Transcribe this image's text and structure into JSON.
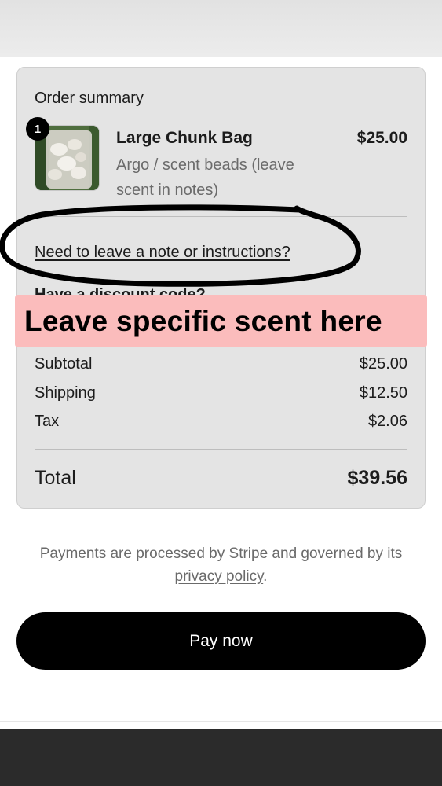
{
  "order_summary": {
    "title": "Order summary",
    "item": {
      "quantity": "1",
      "name": "Large Chunk Bag",
      "variant": "Argo / scent beads (leave scent in notes)",
      "price": "$25.00",
      "image_icon": "product-thumbnail"
    },
    "note_link": "Need to leave a note or instructions?",
    "hidden_text": "Have a discount code?",
    "subtotal_label": "Subtotal",
    "subtotal_value": "$25.00",
    "shipping_label": "Shipping",
    "shipping_value": "$12.50",
    "tax_label": "Tax",
    "tax_value": "$2.06",
    "total_label": "Total",
    "total_value": "$39.56"
  },
  "annotation": {
    "banner_text": "Leave specific scent here",
    "banner_color": "#fbbcbc"
  },
  "payment": {
    "note_text": "Payments are processed by Stripe and governed by its",
    "privacy_link": "privacy policy",
    "note_suffix": ".",
    "pay_button": "Pay now"
  }
}
